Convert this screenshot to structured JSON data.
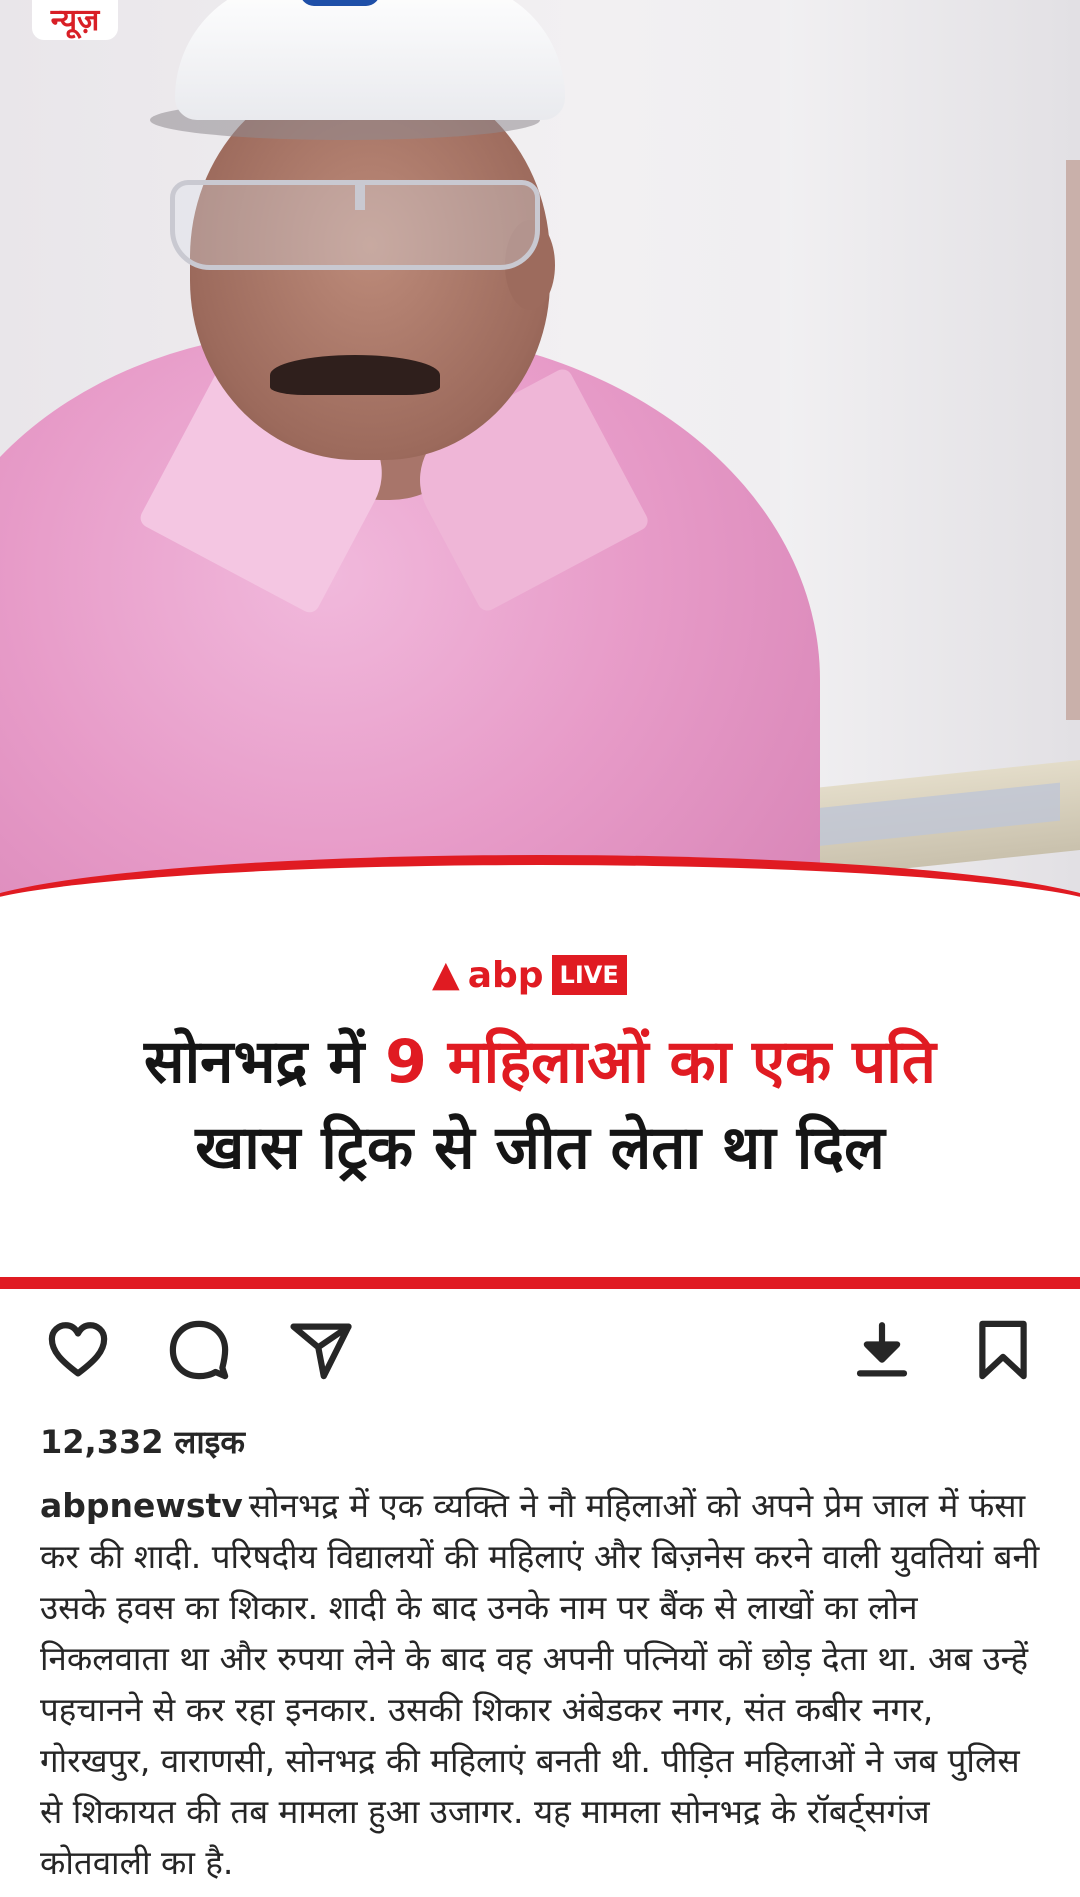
{
  "brand_badge": "न्यूज़",
  "logo": {
    "name": "abp",
    "live": "LIVE"
  },
  "headline": {
    "line1_prefix": "सोनभद्र में ",
    "line1_highlight": "9 महिलाओं का एक पति",
    "line2": "खास ट्रिक से जीत लेता था दिल"
  },
  "actions": {
    "like_icon": "heart-icon",
    "comment_icon": "comment-icon",
    "share_icon": "send-icon",
    "download_icon": "download-icon",
    "save_icon": "bookmark-icon"
  },
  "likes": "12,332 लाइक",
  "caption": {
    "username": "abpnewstv",
    "text": "सोनभद्र में एक व्यक्ति ने नौ महिलाओं को अपने प्रेम जाल में फंसा कर की शादी. परिषदीय विद्यालयों की महिलाएं और बिज़नेस करने वाली युवतियां बनी उसके हवस का शिकार. शादी के बाद उनके नाम पर बैंक से लाखों का लोन निकलवाता था और रुपया लेने के बाद वह अपनी पत्नियों कों छोड़ देता था. अब उन्हें पहचानने से कर रहा इनकार. उसकी शिकार अंबेडकर नगर, संत कबीर नगर, गोरखपुर, वाराणसी, सोनभद्र की महिलाएं बनती थी. पीड़ित महिलाओं ने जब पुलिस से शिकायत की तब मामला हुआ उजागर. यह मामला सोनभद्र के रॉबर्ट्सगंज कोतवाली का है."
  },
  "colors": {
    "accent_red": "#e01b22",
    "text": "#262626"
  }
}
